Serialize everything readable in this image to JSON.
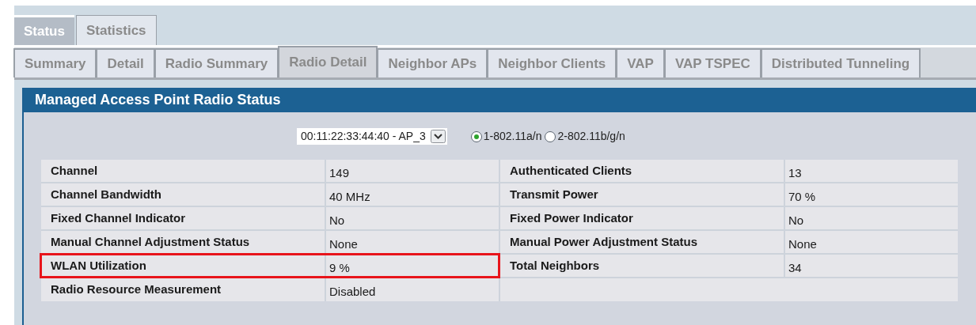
{
  "tabs": [
    {
      "label": "Status",
      "selected": true
    },
    {
      "label": "Statistics",
      "selected": false
    }
  ],
  "subtabs": [
    {
      "label": "Summary",
      "selected": false
    },
    {
      "label": "Detail",
      "selected": false
    },
    {
      "label": "Radio Summary",
      "selected": false
    },
    {
      "label": "Radio Detail",
      "selected": true
    },
    {
      "label": "Neighbor APs",
      "selected": false
    },
    {
      "label": "Neighbor Clients",
      "selected": false
    },
    {
      "label": "VAP",
      "selected": false
    },
    {
      "label": "VAP TSPEC",
      "selected": false
    },
    {
      "label": "Distributed Tunneling",
      "selected": false
    }
  ],
  "panel": {
    "title": "Managed Access Point Radio Status",
    "ap_select": {
      "value": "00:11:22:33:44:40 - AP_3"
    },
    "radios": [
      {
        "label": "1-802.11a/n",
        "selected": true
      },
      {
        "label": "2-802.11b/g/n",
        "selected": false
      }
    ],
    "rows": [
      {
        "left": {
          "label": "Channel",
          "value": "149"
        },
        "right": {
          "label": "Authenticated Clients",
          "value": "13"
        },
        "highlighted": false
      },
      {
        "left": {
          "label": "Channel Bandwidth",
          "value": "40 MHz"
        },
        "right": {
          "label": "Transmit Power",
          "value": "70 %"
        },
        "highlighted": false
      },
      {
        "left": {
          "label": "Fixed Channel Indicator",
          "value": "No"
        },
        "right": {
          "label": "Fixed Power Indicator",
          "value": "No"
        },
        "highlighted": false
      },
      {
        "left": {
          "label": "Manual Channel Adjustment Status",
          "value": "None"
        },
        "right": {
          "label": "Manual Power Adjustment Status",
          "value": "None"
        },
        "highlighted": false
      },
      {
        "left": {
          "label": "WLAN Utilization",
          "value": "9 %"
        },
        "right": {
          "label": "Total Neighbors",
          "value": "34"
        },
        "highlighted": true
      },
      {
        "left": {
          "label": "Radio Resource Measurement",
          "value": "Disabled"
        },
        "highlighted": false
      }
    ]
  }
}
